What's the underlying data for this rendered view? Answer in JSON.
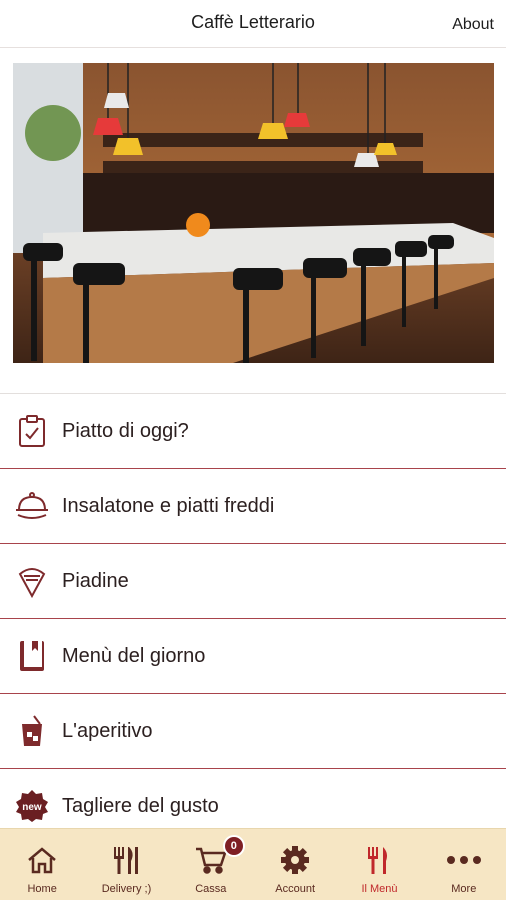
{
  "header": {
    "title": "Caffè Letterario",
    "about_label": "About"
  },
  "menu": {
    "items": [
      {
        "label": "Piatto di oggi?",
        "icon": "clipboard-check-icon"
      },
      {
        "label": "Insalatone e piatti freddi",
        "icon": "cloche-icon"
      },
      {
        "label": "Piadine",
        "icon": "piadina-icon"
      },
      {
        "label": "Menù del giorno",
        "icon": "book-icon"
      },
      {
        "label": "L'aperitivo",
        "icon": "drink-icon"
      },
      {
        "label": "Tagliere del gusto",
        "icon": "new-badge-icon",
        "icon_text": "new"
      }
    ]
  },
  "tabbar": {
    "items": [
      {
        "label": "Home",
        "icon": "home-icon"
      },
      {
        "label": "Delivery ;)",
        "icon": "cutlery-icon"
      },
      {
        "label": "Cassa",
        "icon": "cart-icon",
        "badge": "0"
      },
      {
        "label": "Account",
        "icon": "gear-icon"
      },
      {
        "label": "Il Menù",
        "icon": "fork-knife-icon",
        "active": true
      },
      {
        "label": "More",
        "icon": "more-dots-icon"
      }
    ]
  },
  "colors": {
    "accent": "#a8434b",
    "icon": "#7e2a2c",
    "tabbar_bg": "#f6e6c4",
    "active_tab": "#c0282b"
  }
}
